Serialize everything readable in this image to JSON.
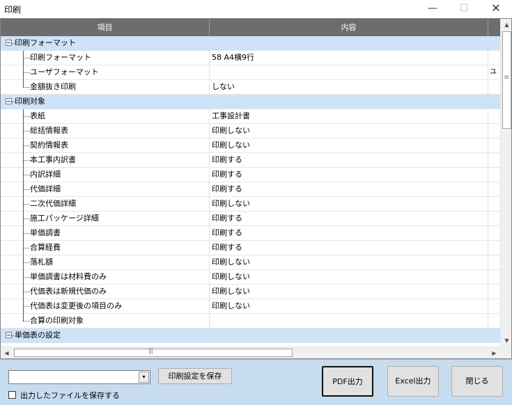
{
  "window": {
    "title": "印刷",
    "minimize_glyph": "—",
    "maximize_glyph": "☐",
    "close_glyph": "✕"
  },
  "grid": {
    "columns": [
      "項目",
      "内容"
    ],
    "rows": [
      {
        "type": "group",
        "label": "印刷フォーマット",
        "value": ""
      },
      {
        "type": "item",
        "label": "印刷フォーマット",
        "value": "58 A4横9行"
      },
      {
        "type": "item",
        "label": "ユーザフォーマット",
        "value": "",
        "overflow": "ユ"
      },
      {
        "type": "item",
        "label": "金額抜き印刷",
        "value": "しない",
        "last": true
      },
      {
        "type": "group",
        "label": "印刷対象",
        "value": ""
      },
      {
        "type": "item",
        "label": "表紙",
        "value": "工事設計書"
      },
      {
        "type": "item",
        "label": "総括情報表",
        "value": "印刷しない"
      },
      {
        "type": "item",
        "label": "契約情報表",
        "value": "印刷しない"
      },
      {
        "type": "item",
        "label": "本工事内訳書",
        "value": "印刷する"
      },
      {
        "type": "item",
        "label": "内訳詳細",
        "value": "印刷する"
      },
      {
        "type": "item",
        "label": "代価詳細",
        "value": "印刷する"
      },
      {
        "type": "item",
        "label": "二次代価詳細",
        "value": "印刷しない"
      },
      {
        "type": "item",
        "label": "施工パッケージ詳細",
        "value": "印刷する"
      },
      {
        "type": "item",
        "label": "単価調書",
        "value": "印刷する"
      },
      {
        "type": "item",
        "label": "合算経費",
        "value": "印刷する"
      },
      {
        "type": "item",
        "label": "落札額",
        "value": "印刷しない"
      },
      {
        "type": "item",
        "label": "単価調書は材料費のみ",
        "value": "印刷しない"
      },
      {
        "type": "item",
        "label": "代価表は新規代価のみ",
        "value": "印刷しない"
      },
      {
        "type": "item",
        "label": "代価表は変更後の項目のみ",
        "value": "印刷しない"
      },
      {
        "type": "item",
        "label": "合算の印刷対象",
        "value": "",
        "last": true
      },
      {
        "type": "group",
        "label": "単価表の設定",
        "value": ""
      }
    ]
  },
  "scroll": {
    "up": "▲",
    "down": "▼",
    "left": "◀",
    "right": "▶"
  },
  "bottom": {
    "combo_value": "",
    "combo_arrow": "▾",
    "save_settings_label": "印刷設定を保存",
    "save_file_checkbox_label": "出力したファイルを保存する",
    "save_file_checked": false,
    "pdf_label": "PDF出力",
    "excel_label": "Excel出力",
    "close_label": "閉じる"
  }
}
